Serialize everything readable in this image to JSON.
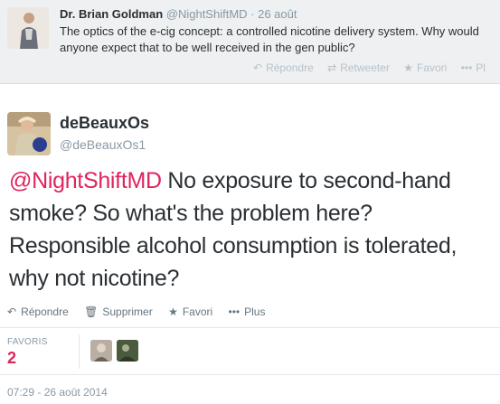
{
  "parent_tweet": {
    "name": "Dr. Brian Goldman",
    "handle": "@NightShiftMD",
    "date": "· 26 août",
    "text": "The optics of the e-cig concept: a controlled nicotine delivery system. Why would anyone expect that to be well received in the gen public?",
    "actions": {
      "reply": "Répondre",
      "retweet": "Retweeter",
      "favorite": "Favori",
      "more": "Pl"
    }
  },
  "tweet": {
    "author_name": "deBeauxOs",
    "author_handle": "@deBeauxOs1",
    "mention": "@NightShiftMD",
    "text": " No exposure to second-hand smoke? So what's the problem here? Responsible alcohol consumption is tolerated, why not nicotine?",
    "actions": {
      "reply": "Répondre",
      "delete": "Supprimer",
      "favorite": "Favori",
      "more": "Plus"
    },
    "favorites_label": "FAVORIS",
    "favorites_count": "2",
    "timestamp": "07:29 - 26 août 2014"
  },
  "colors": {
    "accent": "#e0245e",
    "muted": "#8899a6",
    "text": "#292f33",
    "context_bg": "#eef0f1"
  },
  "icons": {
    "reply": "reply-arrow-icon",
    "retweet": "retweet-icon",
    "favorite": "star-icon",
    "more": "ellipsis-icon",
    "delete": "trash-icon"
  }
}
